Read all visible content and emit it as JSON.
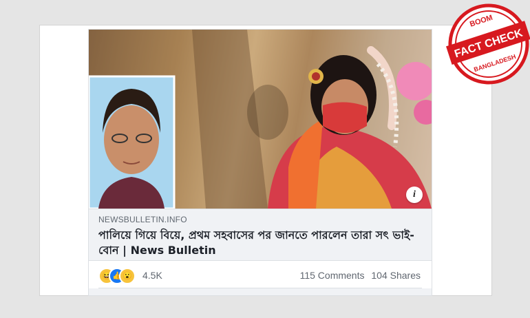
{
  "post": {
    "domain": "NEWSBULLETIN.INFO",
    "headline": "পালিয়ে গিয়ে বিয়ে, প্রথম সহবাসের পর জানতে পারলেন তারা সৎ ভাই-বোন | News Bulletin",
    "info_icon": "i"
  },
  "stats": {
    "reaction_count": "4.5K",
    "comments": "115 Comments",
    "shares": "104 Shares"
  },
  "stamp": {
    "top": "BOOM",
    "main": "FACT CHECK",
    "bottom": "BANGLADESH"
  },
  "colors": {
    "stamp_red": "#d7191f",
    "like_blue": "#1877f2",
    "haha_yellow": "#f7c33b"
  }
}
